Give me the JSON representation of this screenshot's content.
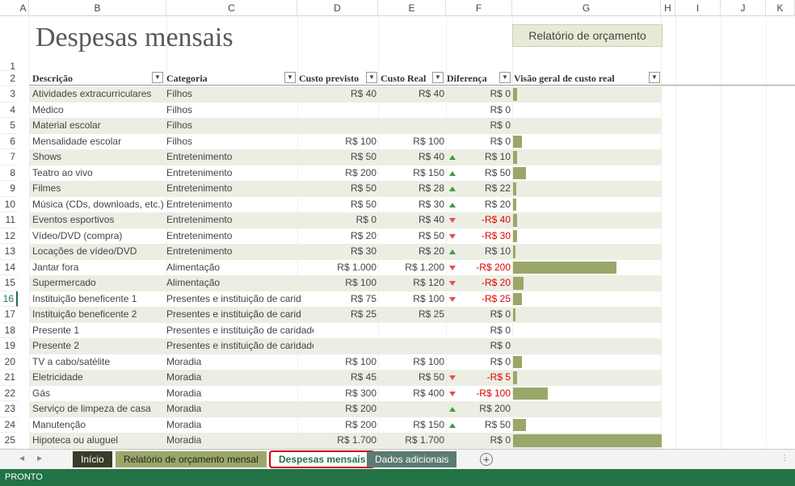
{
  "sheet": {
    "columns": [
      "A",
      "B",
      "C",
      "D",
      "E",
      "F",
      "G",
      "H",
      "I",
      "J",
      "K"
    ],
    "title": "Despesas mensais",
    "report_button": "Relatório de orçamento",
    "headers": [
      "Descrição",
      "Categoria",
      "Custo previsto",
      "Custo Real",
      "Diferença",
      "Visão geral de custo real"
    ],
    "selected_row": 16,
    "rows": [
      {
        "n": 1
      },
      {
        "n": 2
      },
      {
        "n": 3,
        "desc": "Atividades extracurriculares",
        "cat": "Filhos",
        "prev": "R$ 40",
        "real": "R$ 40",
        "ind": "",
        "diff": "R$ 0",
        "neg": false,
        "bar": 0.3
      },
      {
        "n": 4,
        "desc": "Médico",
        "cat": "Filhos",
        "prev": "",
        "real": "",
        "ind": "",
        "diff": "R$ 0",
        "neg": false,
        "bar": 0
      },
      {
        "n": 5,
        "desc": "Material escolar",
        "cat": "Filhos",
        "prev": "",
        "real": "",
        "ind": "",
        "diff": "R$ 0",
        "neg": false,
        "bar": 0
      },
      {
        "n": 6,
        "desc": "Mensalidade escolar",
        "cat": "Filhos",
        "prev": "R$ 100",
        "real": "R$ 100",
        "ind": "",
        "diff": "R$ 0",
        "neg": false,
        "bar": 0.6
      },
      {
        "n": 7,
        "desc": "Shows",
        "cat": "Entretenimento",
        "prev": "R$ 50",
        "real": "R$ 40",
        "ind": "up",
        "diff": "R$ 10",
        "neg": false,
        "bar": 0.3
      },
      {
        "n": 8,
        "desc": "Teatro ao vivo",
        "cat": "Entretenimento",
        "prev": "R$ 200",
        "real": "R$ 150",
        "ind": "up",
        "diff": "R$ 50",
        "neg": false,
        "bar": 0.9
      },
      {
        "n": 9,
        "desc": "Filmes",
        "cat": "Entretenimento",
        "prev": "R$ 50",
        "real": "R$ 28",
        "ind": "up",
        "diff": "R$ 22",
        "neg": false,
        "bar": 0.2
      },
      {
        "n": 10,
        "desc": "Música (CDs, downloads, etc.)",
        "cat": "Entretenimento",
        "prev": "R$ 50",
        "real": "R$ 30",
        "ind": "up",
        "diff": "R$ 20",
        "neg": false,
        "bar": 0.2
      },
      {
        "n": 11,
        "desc": "Eventos esportivos",
        "cat": "Entretenimento",
        "prev": "R$ 0",
        "real": "R$ 40",
        "ind": "down",
        "diff": "-R$ 40",
        "neg": true,
        "bar": 0.3
      },
      {
        "n": 12,
        "desc": "Vídeo/DVD (compra)",
        "cat": "Entretenimento",
        "prev": "R$ 20",
        "real": "R$ 50",
        "ind": "down",
        "diff": "-R$ 30",
        "neg": true,
        "bar": 0.3
      },
      {
        "n": 13,
        "desc": "Locações de vídeo/DVD",
        "cat": "Entretenimento",
        "prev": "R$ 30",
        "real": "R$ 20",
        "ind": "up",
        "diff": "R$ 10",
        "neg": false,
        "bar": 0.15
      },
      {
        "n": 14,
        "desc": "Jantar fora",
        "cat": "Alimentação",
        "prev": "R$ 1.000",
        "real": "R$ 1.200",
        "ind": "down",
        "diff": "-R$ 200",
        "neg": true,
        "bar": 7.1
      },
      {
        "n": 15,
        "desc": "Supermercado",
        "cat": "Alimentação",
        "prev": "R$ 100",
        "real": "R$ 120",
        "ind": "down",
        "diff": "-R$ 20",
        "neg": true,
        "bar": 0.7
      },
      {
        "n": 16,
        "desc": "Instituição beneficente 1",
        "cat": "Presentes e instituição de carid",
        "prev": "R$ 75",
        "real": "R$ 100",
        "ind": "down",
        "diff": "-R$ 25",
        "neg": true,
        "bar": 0.6
      },
      {
        "n": 17,
        "desc": "Instituição beneficente 2",
        "cat": "Presentes e instituição de carid",
        "prev": "R$ 25",
        "real": "R$ 25",
        "ind": "",
        "diff": "R$ 0",
        "neg": false,
        "bar": 0.15
      },
      {
        "n": 18,
        "desc": "Presente 1",
        "cat": "Presentes e instituição de caridade",
        "prev": "",
        "real": "",
        "ind": "",
        "diff": "R$ 0",
        "neg": false,
        "bar": 0
      },
      {
        "n": 19,
        "desc": "Presente 2",
        "cat": "Presentes e instituição de caridade",
        "prev": "",
        "real": "",
        "ind": "",
        "diff": "R$ 0",
        "neg": false,
        "bar": 0
      },
      {
        "n": 20,
        "desc": "TV a cabo/satélite",
        "cat": "Moradia",
        "prev": "R$ 100",
        "real": "R$ 100",
        "ind": "",
        "diff": "R$ 0",
        "neg": false,
        "bar": 0.6
      },
      {
        "n": 21,
        "desc": "Eletricidade",
        "cat": "Moradia",
        "prev": "R$ 45",
        "real": "R$ 50",
        "ind": "down",
        "diff": "-R$ 5",
        "neg": true,
        "bar": 0.3
      },
      {
        "n": 22,
        "desc": "Gás",
        "cat": "Moradia",
        "prev": "R$ 300",
        "real": "R$ 400",
        "ind": "down",
        "diff": "-R$ 100",
        "neg": true,
        "bar": 2.4
      },
      {
        "n": 23,
        "desc": "Serviço de limpeza de casa",
        "cat": "Moradia",
        "prev": "R$ 200",
        "real": "",
        "ind": "up",
        "diff": "R$ 200",
        "neg": false,
        "bar": 0
      },
      {
        "n": 24,
        "desc": "Manutenção",
        "cat": "Moradia",
        "prev": "R$ 200",
        "real": "R$ 150",
        "ind": "up",
        "diff": "R$ 50",
        "neg": false,
        "bar": 0.9
      },
      {
        "n": 25,
        "desc": "Hipoteca ou aluguel",
        "cat": "Moradia",
        "prev": "R$ 1.700",
        "real": "R$ 1.700",
        "ind": "",
        "diff": "R$ 0",
        "neg": false,
        "bar": 10.2
      }
    ]
  },
  "tabs": [
    {
      "label": "Início",
      "bg": "#3b3b2a",
      "fg": "#ffffff"
    },
    {
      "label": "Relatório de orçamento mensal",
      "bg": "#9aa76a",
      "fg": "#222222"
    },
    {
      "label": "Despesas mensais",
      "bg": "#ffffff",
      "fg": "#217346",
      "active": true
    },
    {
      "label": "Dados adicionais",
      "bg": "#5b7a72",
      "fg": "#ffffff"
    }
  ],
  "status": "PRONTO",
  "colors": {
    "accent": "#217346",
    "band": "#eceee3",
    "bar": "#9aa76a",
    "negative": "#e00000",
    "highlight": "#cc0000"
  }
}
